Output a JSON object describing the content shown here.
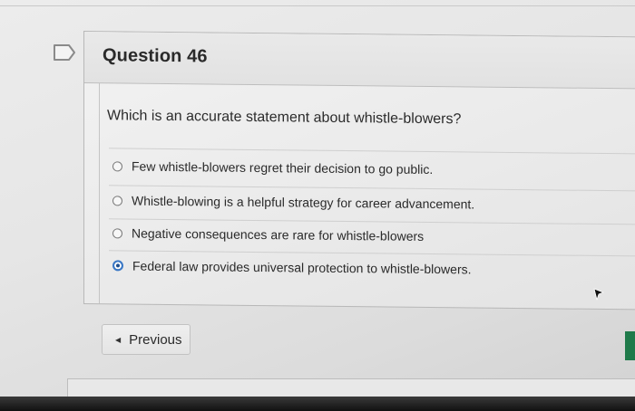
{
  "question": {
    "title": "Question 46",
    "text": "Which is an accurate statement about whistle-blowers?",
    "options": [
      {
        "label": "Few whistle-blowers regret their decision to go public.",
        "selected": false
      },
      {
        "label": "Whistle-blowing is a helpful strategy for career advancement.",
        "selected": false
      },
      {
        "label": "Negative consequences are rare for whistle-blowers",
        "selected": false
      },
      {
        "label": "Federal law provides universal protection to whistle-blowers.",
        "selected": true
      }
    ]
  },
  "navigation": {
    "previous_label": "Previous",
    "previous_icon": "caret-left-icon"
  },
  "icons": {
    "flag": "flag-icon",
    "cursor": "mouse-cursor-icon"
  },
  "colors": {
    "selected_radio": "#3a78c6",
    "accent_tab": "#1f7a4a"
  }
}
